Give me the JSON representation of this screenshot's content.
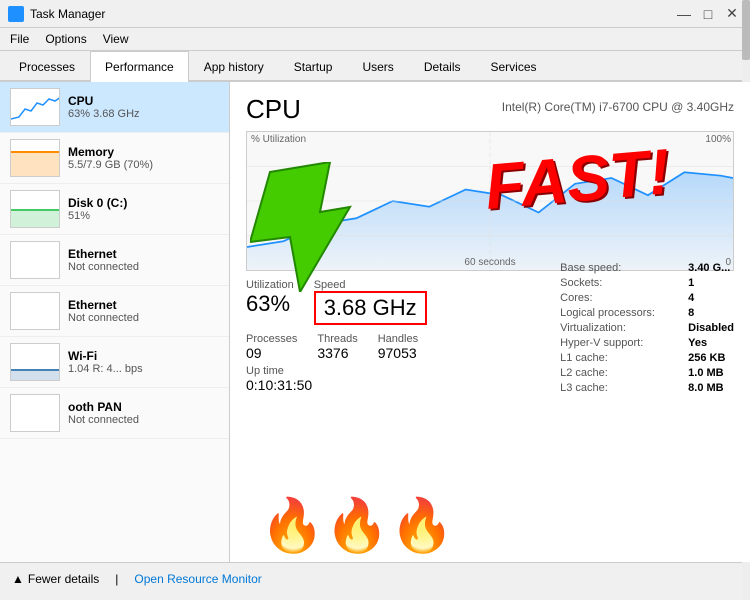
{
  "titleBar": {
    "icon": "task-manager-icon",
    "title": "Task Manager",
    "minimize": "—",
    "maximize": "□",
    "close": "✕"
  },
  "menuBar": {
    "items": [
      "File",
      "Options",
      "View"
    ]
  },
  "tabs": [
    {
      "label": "Processes",
      "active": false
    },
    {
      "label": "Performance",
      "active": true
    },
    {
      "label": "App history",
      "active": false
    },
    {
      "label": "Startup",
      "active": false
    },
    {
      "label": "Users",
      "active": false
    },
    {
      "label": "Details",
      "active": false
    },
    {
      "label": "Services",
      "active": false
    }
  ],
  "leftPanel": {
    "resources": [
      {
        "name": "CPU",
        "sub": "63% 3.68 GHz",
        "type": "cpu",
        "active": true
      },
      {
        "name": "Memory",
        "sub": "5.5/7.9 GB (70%)",
        "type": "memory",
        "active": false
      },
      {
        "name": "Disk 0 (C:)",
        "sub": "51%",
        "type": "disk",
        "active": false
      },
      {
        "name": "Ethernet",
        "sub": "Not connected",
        "type": "ethernet",
        "active": false
      },
      {
        "name": "Ethernet",
        "sub": "Not connected",
        "type": "ethernet2",
        "active": false
      },
      {
        "name": "Wi-Fi",
        "sub": "1.04 R: 4... bps",
        "type": "wifi",
        "active": false
      },
      {
        "name": "ooth PAN",
        "sub": "Not connected",
        "type": "bluetooth",
        "active": false
      }
    ]
  },
  "rightPanel": {
    "title": "CPU",
    "subtitle": "Intel(R) Core(TM) i7-6700 CPU @ 3.40GHz",
    "chartLabel": "% Utilization",
    "chart100": "100%",
    "chart0": "0",
    "chartTime": "60 seconds",
    "utilization": {
      "label": "Utilization",
      "value": "63%"
    },
    "speed": {
      "label": "Speed",
      "value": "3.68 GHz"
    },
    "processes": {
      "label": "Processes",
      "value": "09"
    },
    "threads": {
      "label": "Threads",
      "value": "3376"
    },
    "handles": {
      "label": "Handles",
      "value": "97053"
    },
    "uptime": {
      "label": "Up time",
      "value": "0:10:31:50"
    },
    "infoTable": {
      "rows": [
        {
          "key": "Base speed:",
          "val": "3.40 G..."
        },
        {
          "key": "Sockets:",
          "val": "1"
        },
        {
          "key": "Cores:",
          "val": "4"
        },
        {
          "key": "Logical processors:",
          "val": "8"
        },
        {
          "key": "Virtualization:",
          "val": "Disabled"
        },
        {
          "key": "Hyper-V support:",
          "val": "Yes"
        },
        {
          "key": "L1 cache:",
          "val": "256 KB"
        },
        {
          "key": "L2 cache:",
          "val": "1.0 MB"
        },
        {
          "key": "L3 cache:",
          "val": "8.0 MB"
        }
      ]
    },
    "fastText": "FAST!",
    "flamesEmoji": "🔥🔥🔥"
  },
  "bottomBar": {
    "fewerDetails": "Fewer details",
    "openMonitor": "Open Resource Monitor"
  }
}
